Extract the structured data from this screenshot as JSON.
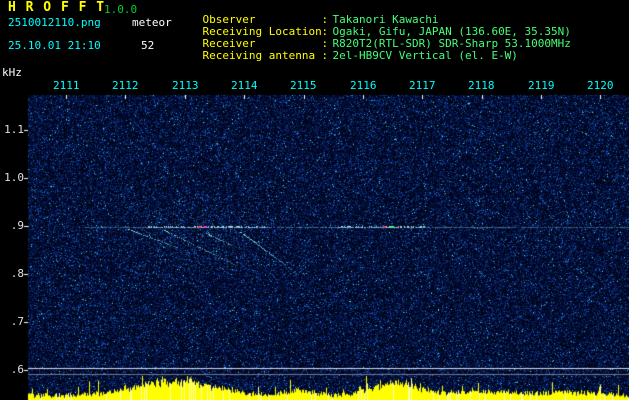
{
  "header": {
    "title": "H R O F F T",
    "version": "1.0.0",
    "filename": "2510012110.png",
    "mode": "meteor",
    "datetime": "25.10.01 21:10",
    "count": "52",
    "colon": ":",
    "info": [
      {
        "label": "Observer",
        "value": "Takanori Kawachi"
      },
      {
        "label": "Receiving Location",
        "value": "Ogaki, Gifu, JAPAN (136.60E, 35.35N)"
      },
      {
        "label": "Receiver",
        "value": "R820T2(RTL-SDR) SDR-Sharp 53.1000MHz"
      },
      {
        "label": "Receiving antenna",
        "value": "2el-HB9CV Vertical (el. E-W)"
      }
    ]
  },
  "axes": {
    "y_unit": "kHz",
    "y_ticks": [
      "1.1",
      "1.0",
      ".9",
      ".8",
      ".7",
      ".6"
    ],
    "x_ticks": [
      "2111",
      "2112",
      "2113",
      "2114",
      "2115",
      "2116",
      "2117",
      "2118",
      "2119",
      "2120"
    ]
  },
  "colors": {
    "background": "#000000",
    "label_yellow": "#ffff00",
    "value_green": "#44ff77",
    "time_label_cyan": "#00ffff",
    "axis_label_white": "#ffffff",
    "noise_blue": "#0030a0",
    "echo_line_cyan": "#8ce6ff",
    "signal_bar_yellow": "#ffff00"
  },
  "chart_data": {
    "type": "heatmap",
    "description": "HROFFT 10-minute radio meteor observation spectrogram: dark blue noise field, horizontal carrier/echo line at 0.9 kHz, diagonal Doppler head-echo streaks near 2112-2114, bright overdense echo near 2116, yellow signal-strength bars along the bottom edge",
    "x_ticks_time_hhmm": [
      "2111",
      "2112",
      "2113",
      "2114",
      "2115",
      "2116",
      "2117",
      "2118",
      "2119",
      "2120"
    ],
    "ylabel": "kHz",
    "y_ticks_khz": [
      1.1,
      1.0,
      0.9,
      0.8,
      0.7,
      0.6
    ],
    "ylim_khz": [
      0.55,
      1.17
    ],
    "carrier_line_khz": 0.9,
    "carrier_line_span_hhmm": [
      "2111.3",
      "2120"
    ],
    "reference_lines_khz": [
      0.6,
      0.59
    ],
    "meteor_events": [
      {
        "time_hhmm": "2112.0",
        "freq_khz": 0.9,
        "kind": "diagonal doppler streak"
      },
      {
        "time_hhmm": "2112.7",
        "freq_khz": 0.9,
        "kind": "diagonal doppler streak"
      },
      {
        "time_hhmm": "2113.3",
        "freq_khz": 0.9,
        "kind": "short doppler streak"
      },
      {
        "time_hhmm": "2113.9",
        "freq_khz": 0.9,
        "kind": "diagonal doppler streak"
      },
      {
        "time_hhmm": "2116.3",
        "freq_khz": 0.9,
        "kind": "bright overdense echo (red/green hotspot)"
      }
    ],
    "signal_strength_peaks_hhmm": [
      "2112-2114",
      "2116-2117"
    ],
    "echo_count_displayed": 52
  }
}
